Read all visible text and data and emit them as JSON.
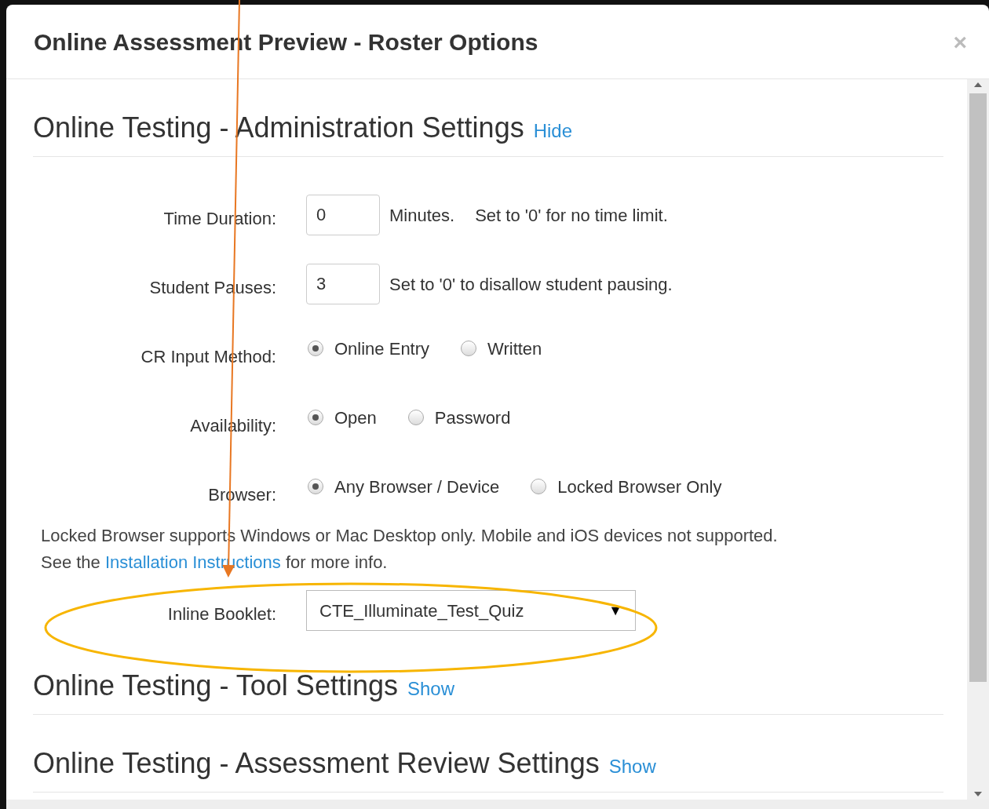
{
  "dialog": {
    "title": "Online Assessment Preview - Roster Options",
    "close": "×"
  },
  "sections": [
    {
      "title": "Online Testing - Administration Settings",
      "toggle": "Hide",
      "fields": [
        {
          "kind": "number",
          "label": "Time Duration:",
          "value": "0",
          "notes": [
            "Minutes.",
            "Set to '0' for no time limit."
          ]
        },
        {
          "kind": "number",
          "label": "Student Pauses:",
          "value": "3",
          "notes": [
            "Set to '0' to disallow student pausing."
          ]
        },
        {
          "kind": "radio",
          "label": "CR Input Method:",
          "options": [
            {
              "label": "Online Entry",
              "selected": true
            },
            {
              "label": "Written",
              "selected": false
            }
          ]
        },
        {
          "kind": "radio",
          "label": "Availability:",
          "options": [
            {
              "label": "Open",
              "selected": true
            },
            {
              "label": "Password",
              "selected": false
            }
          ]
        },
        {
          "kind": "radio",
          "label": "Browser:",
          "options": [
            {
              "label": "Any Browser / Device",
              "selected": true
            },
            {
              "label": "Locked Browser Only",
              "selected": false
            }
          ]
        },
        {
          "kind": "info",
          "lines": [
            "Locked Browser supports Windows or Mac Desktop only. Mobile and iOS devices not supported."
          ],
          "before": "See the",
          "link": "Installation Instructions",
          "after": "for more info."
        },
        {
          "kind": "select",
          "label": "Inline Booklet:",
          "value": "CTE_Illuminate_Test_Quiz",
          "caret": "▼"
        }
      ]
    },
    {
      "title": "Online Testing - Tool Settings",
      "toggle": "Show"
    },
    {
      "title": "Online Testing - Assessment Review Settings",
      "toggle": "Show"
    }
  ]
}
